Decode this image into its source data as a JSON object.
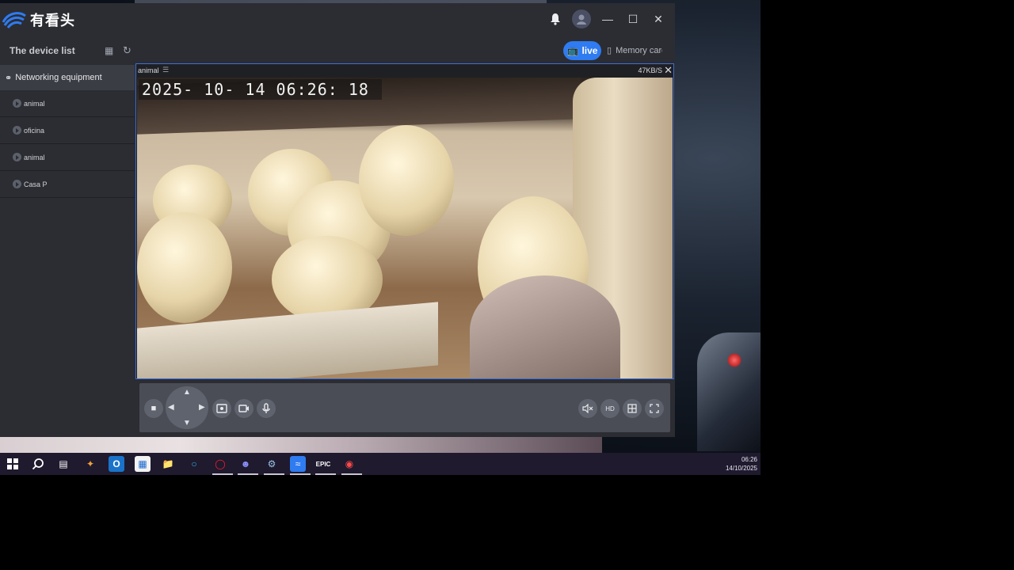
{
  "app": {
    "brand_name": "有看头"
  },
  "subbar": {
    "device_list_title": "The device list",
    "live_label": "live",
    "memory_label": "Memory card"
  },
  "sidebar": {
    "group_label": "Networking equipment",
    "devices": [
      {
        "label": "animal"
      },
      {
        "label": "oficina"
      },
      {
        "label": "animal"
      },
      {
        "label": "Casa P"
      }
    ]
  },
  "video": {
    "camera_name": "animal",
    "bitrate": "47KB/S",
    "timestamp": "2025- 10- 14  06:26: 18"
  },
  "controls": {
    "hd_label": "HD"
  },
  "taskbar": {
    "time": "06:26",
    "date": "14/10/2025"
  },
  "colors": {
    "accent": "#2f7bf1",
    "window_bg": "#2b2d33",
    "selection_border": "#3d6fd6"
  }
}
